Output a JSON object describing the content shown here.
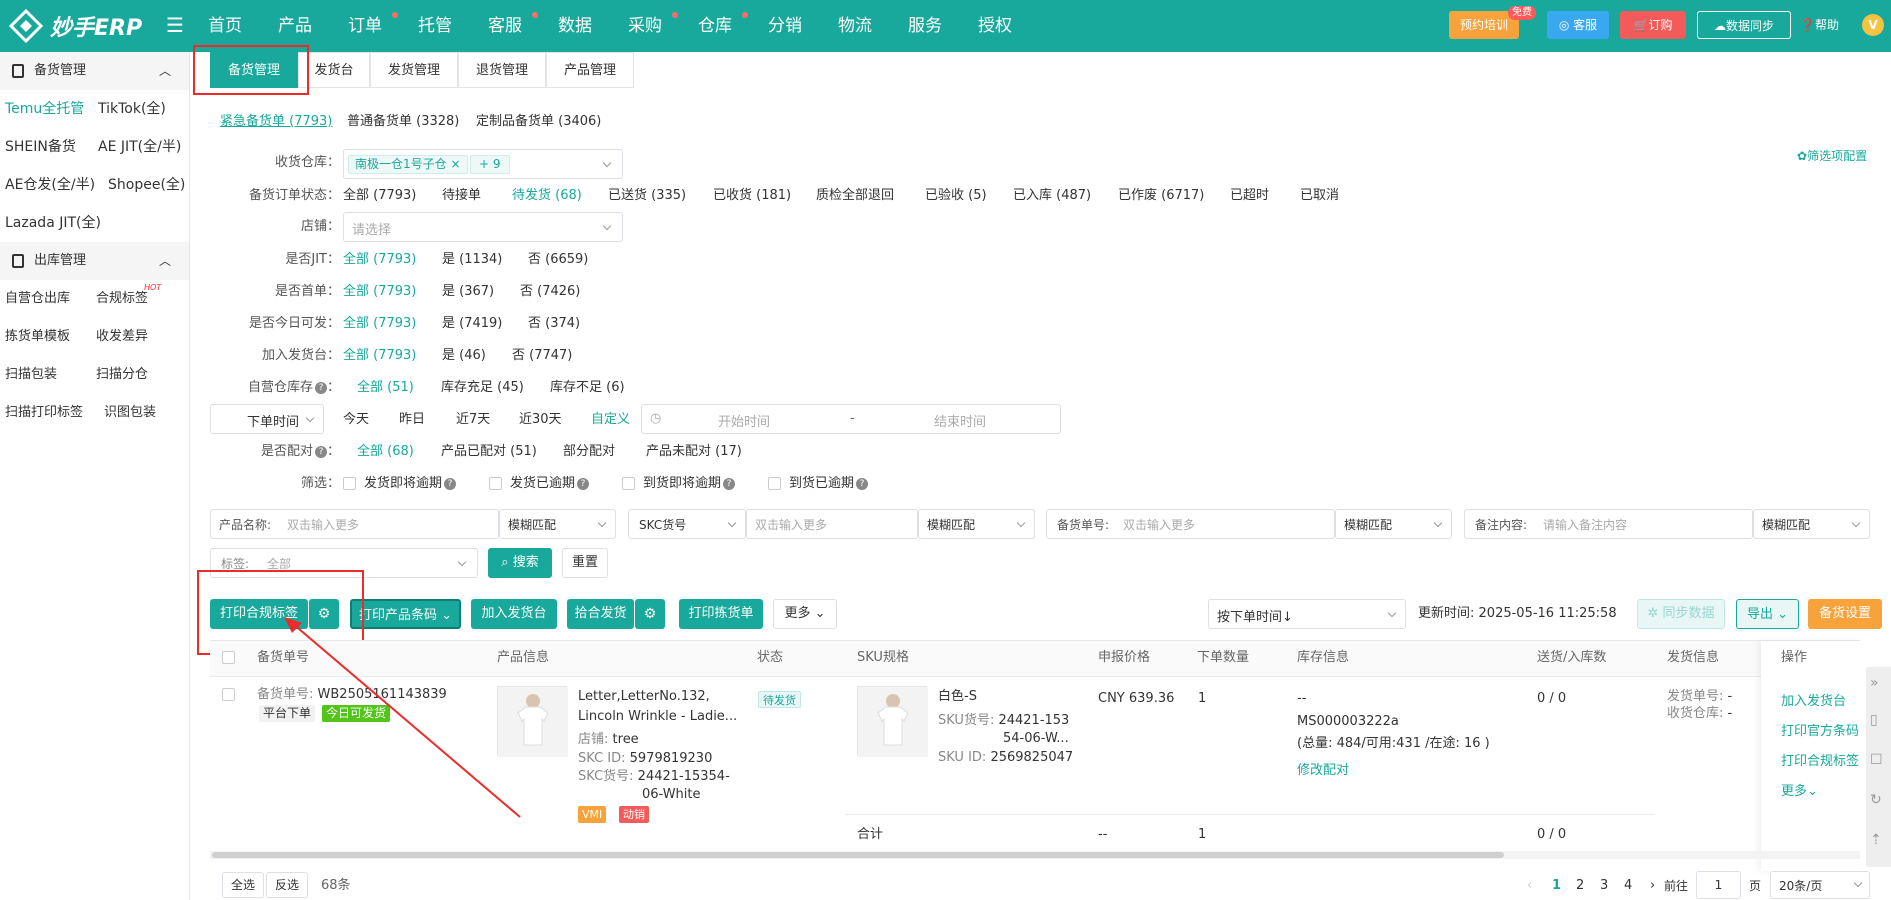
{
  "brand": {
    "name": "妙手ERP"
  },
  "topnav": [
    {
      "label": "首页",
      "dot": false
    },
    {
      "label": "产品",
      "dot": false
    },
    {
      "label": "订单",
      "dot": true
    },
    {
      "label": "托管",
      "dot": false
    },
    {
      "label": "客服",
      "dot": true
    },
    {
      "label": "数据",
      "dot": false
    },
    {
      "label": "采购",
      "dot": true
    },
    {
      "label": "仓库",
      "dot": true
    },
    {
      "label": "分销",
      "dot": false
    },
    {
      "label": "物流",
      "dot": false
    },
    {
      "label": "服务",
      "dot": false
    },
    {
      "label": "授权",
      "dot": false
    }
  ],
  "topright": {
    "training": "预约培训",
    "free_badge": "免费",
    "service": "客服",
    "order": "订购",
    "sync": "数据同步",
    "help": "帮助",
    "avatar": "V"
  },
  "sidebar": {
    "group1": "备货管理",
    "group1_items": [
      [
        "Temu全托管",
        "TikTok(全)"
      ],
      [
        "SHEIN备货",
        "AE JIT(全/半)"
      ],
      [
        "AE仓发(全/半)",
        "Shopee(全)"
      ],
      [
        "Lazada JIT(全)",
        ""
      ]
    ],
    "group2": "出库管理",
    "group2_items": [
      [
        "自营仓出库",
        "合规标签"
      ],
      [
        "拣货单模板",
        "收发差异"
      ],
      [
        "扫描包装",
        "扫描分仓"
      ],
      [
        "扫描打印标签",
        "识图包装"
      ]
    ],
    "hot": "HOT"
  },
  "tabs": [
    "备货管理",
    "发货台",
    "发货管理",
    "退货管理",
    "产品管理"
  ],
  "subtabs": [
    "紧急备货单 (7793)",
    "普通备货单 (3328)",
    "定制品备货单 (3406)"
  ],
  "filter_config": "筛选项配置",
  "filters": {
    "warehouse": {
      "label": "收货仓库：",
      "chip": "南极一仓1号子仓",
      "more": "+ 9"
    },
    "status": {
      "label": "备货订单状态：",
      "options": [
        "全部 (7793)",
        "待接单",
        "待发货 (68)",
        "已送货 (335)",
        "已收货 (181)",
        "质检全部退回",
        "已验收 (5)",
        "已入库 (487)",
        "已作废 (6717)",
        "已超时",
        "已取消"
      ]
    },
    "shop": {
      "label": "店铺：",
      "placeholder": "请选择"
    },
    "jit": {
      "label": "是否JIT：",
      "options": [
        "全部 (7793)",
        "是 (1134)",
        "否 (6659)"
      ]
    },
    "first": {
      "label": "是否首单：",
      "options": [
        "全部 (7793)",
        "是 (367)",
        "否 (7426)"
      ]
    },
    "today": {
      "label": "是否今日可发：",
      "options": [
        "全部 (7793)",
        "是 (7419)",
        "否 (374)"
      ]
    },
    "desk": {
      "label": "加入发货台：",
      "options": [
        "全部 (7793)",
        "是 (46)",
        "否 (7747)"
      ]
    },
    "stock": {
      "label": "自营仓库存",
      "options": [
        "全部 (51)",
        "库存充足 (45)",
        "库存不足 (6)"
      ]
    },
    "time": {
      "select": "下单时间",
      "options": [
        "今天",
        "昨日",
        "近7天",
        "近30天",
        "自定义"
      ],
      "start": "开始时间",
      "sep": "-",
      "end": "结束时间"
    },
    "match": {
      "label": "是否配对",
      "options": [
        "全部 (68)",
        "产品已配对 (51)",
        "部分配对",
        "产品未配对 (17)"
      ]
    },
    "screen": {
      "label": "筛选：",
      "options": [
        "发货即将逾期",
        "发货已逾期",
        "到货即将逾期",
        "到货已逾期"
      ]
    }
  },
  "search": {
    "product_label": "产品名称:",
    "product_ph": "双击输入更多",
    "fuzzy": "模糊匹配",
    "skc_label": "SKC货号",
    "skc_ph": "双击输入更多",
    "order_label": "备货单号:",
    "order_ph": "双击输入更多",
    "note_label": "备注内容:",
    "note_ph": "请输入备注内容",
    "tag_label": "标签:",
    "tag_value": "全部",
    "search_btn": "搜索",
    "reset_btn": "重置"
  },
  "actions": {
    "print_label": "打印合规标签",
    "print_barcode": "打印产品条码",
    "add_desk": "加入发货台",
    "pickup": "拾合发货",
    "print_pick": "打印拣货单",
    "more": "更多",
    "sort": "按下单时间↓",
    "updated_label": "更新时间:",
    "updated_value": "2025-05-16 11:25:58",
    "sync": "同步数据",
    "export": "导出",
    "settings": "备货设置"
  },
  "table": {
    "headers": [
      "备货单号",
      "产品信息",
      "状态",
      "SKU规格",
      "申报价格",
      "下单数量",
      "库存信息",
      "送货/入库数",
      "发货信息",
      "操作"
    ],
    "row": {
      "order_label": "备货单号:",
      "order_no": "WB2505161143839",
      "platform": "平台下单",
      "today_tag": "今日可发货",
      "product_title1": "Letter,LetterNo.132,",
      "product_title2": "Lincoln Wrinkle - Ladie...",
      "shop_label": "店铺:",
      "shop": "tree",
      "skc_id_label": "SKC ID:",
      "skc_id": "5979819230",
      "skc_no_label": "SKC货号:",
      "skc_no1": "24421-15354-",
      "skc_no2": "06-White",
      "tag_vmi": "VMI",
      "tag_dyn": "动销",
      "status": "待发货",
      "sku_name": "白色-S",
      "sku_no_label": "SKU货号:",
      "sku_no1": "24421-153",
      "sku_no2": "54-06-W...",
      "sku_id_label": "SKU ID:",
      "sku_id": "2569825047",
      "price": "CNY 639.36",
      "qty": "1",
      "stock_dash": "--",
      "stock_code": "MS000003222a",
      "stock_detail": "(总量: 484/可用:431 /在途: 16 )",
      "stock_edit": "修改配对",
      "delivered": "0 / 0",
      "ship_order_label": "发货单号:",
      "ship_order": "-",
      "ship_wh_label": "收货仓库:",
      "ship_wh": "-",
      "ops": [
        "加入发货台",
        "打印官方条码",
        "打印合规标签",
        "更多"
      ]
    },
    "total": {
      "label": "合计",
      "price": "--",
      "qty": "1",
      "delivered": "0 / 0"
    }
  },
  "footer": {
    "select_all": "全选",
    "invert": "反选",
    "count": "68条",
    "pages": [
      "1",
      "2",
      "3",
      "4"
    ],
    "goto": "前往",
    "page_input": "1",
    "page_unit": "页",
    "page_size": "20条/页"
  }
}
